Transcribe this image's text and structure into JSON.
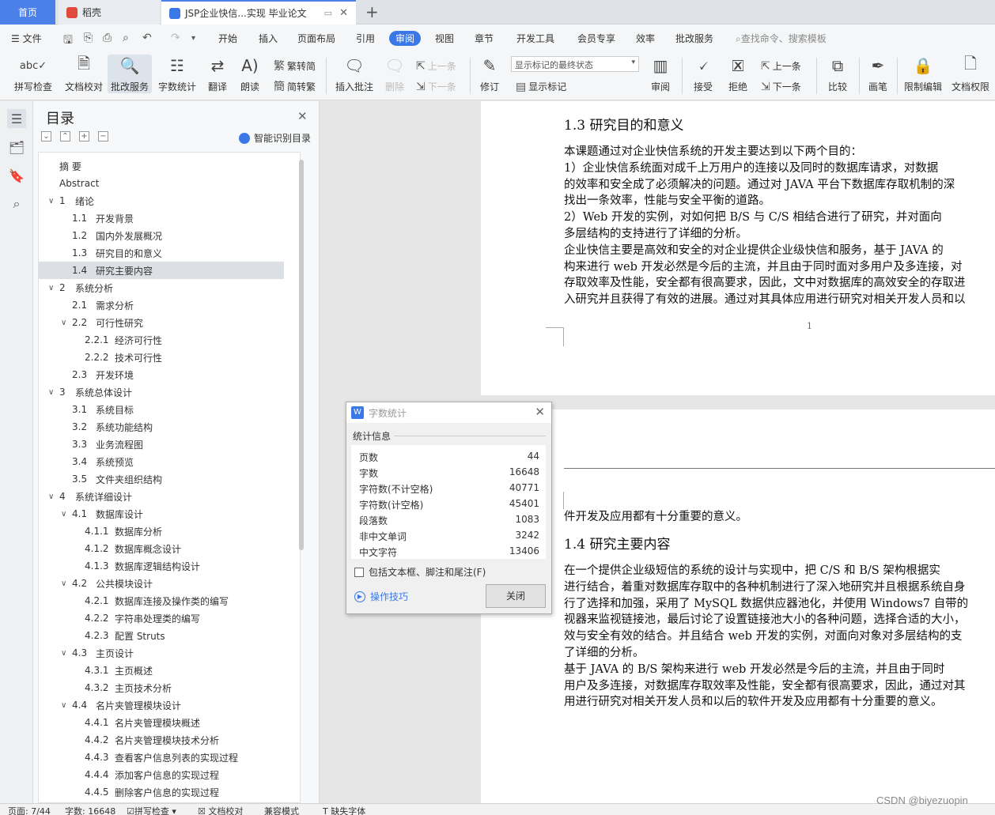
{
  "tabs": {
    "home": "首页",
    "daoke": "稻壳",
    "doc": "JSP企业快信...实现 毕业论文"
  },
  "menu": {
    "file": "文件",
    "items": [
      "开始",
      "插入",
      "页面布局",
      "引用",
      "审阅",
      "视图",
      "章节",
      "开发工具",
      "会员专享",
      "效率",
      "批改服务"
    ],
    "active": "审阅",
    "search": "查找命令、搜索模板"
  },
  "ribbon": {
    "spellcheck": "拼写检查",
    "doc_check": "文档校对",
    "revise_service": "批改服务",
    "word_count": "字数统计",
    "translate": "翻译",
    "read_aloud": "朗读",
    "trad_to_simp": "繁转简",
    "simp_to_trad": "简转繁",
    "insert_comment": "插入批注",
    "delete": "删除",
    "prev": "上一条",
    "next": "下一条",
    "track": "修订",
    "markup_select": "显示标记的最终状态",
    "show_markup": "显示标记",
    "review": "审阅",
    "accept": "接受",
    "reject": "拒绝",
    "prev2": "上一条",
    "next2": "下一条",
    "compare": "比较",
    "pen": "画笔",
    "restrict_edit": "限制编辑",
    "doc_rights": "文档权限"
  },
  "toc": {
    "title": "目录",
    "smart": "智能识别目录",
    "items": [
      {
        "num": "",
        "text": "摘  要",
        "level": 0
      },
      {
        "num": "",
        "text": "Abstract",
        "level": 0
      },
      {
        "num": "1",
        "text": "绪论",
        "level": 1,
        "expand": true
      },
      {
        "num": "1.1",
        "text": "开发背景",
        "level": 2
      },
      {
        "num": "1.2",
        "text": "国内外发展概况",
        "level": 2
      },
      {
        "num": "1.3",
        "text": "研究目的和意义",
        "level": 2
      },
      {
        "num": "1.4",
        "text": "研究主要内容",
        "level": 2,
        "selected": true
      },
      {
        "num": "2",
        "text": "系统分析",
        "level": 1,
        "expand": true
      },
      {
        "num": "2.1",
        "text": "需求分析",
        "level": 2
      },
      {
        "num": "2.2",
        "text": "可行性研究",
        "level": 2,
        "expand": true
      },
      {
        "num": "2.2.1",
        "text": "经济可行性",
        "level": 3
      },
      {
        "num": "2.2.2",
        "text": "技术可行性",
        "level": 3
      },
      {
        "num": "2.3",
        "text": "开发环境",
        "level": 2
      },
      {
        "num": "3",
        "text": "系统总体设计",
        "level": 1,
        "expand": true
      },
      {
        "num": "3.1",
        "text": "系统目标",
        "level": 2
      },
      {
        "num": "3.2",
        "text": "系统功能结构",
        "level": 2
      },
      {
        "num": "3.3",
        "text": "业务流程图",
        "level": 2
      },
      {
        "num": "3.4",
        "text": "系统预览",
        "level": 2
      },
      {
        "num": "3.5",
        "text": "文件夹组织结构",
        "level": 2
      },
      {
        "num": "4",
        "text": "系统详细设计",
        "level": 1,
        "expand": true
      },
      {
        "num": "4.1",
        "text": "数据库设计",
        "level": 2,
        "expand": true
      },
      {
        "num": "4.1.1",
        "text": "数据库分析",
        "level": 3
      },
      {
        "num": "4.1.2",
        "text": "数据库概念设计",
        "level": 3
      },
      {
        "num": "4.1.3",
        "text": "数据库逻辑结构设计",
        "level": 3
      },
      {
        "num": "4.2",
        "text": "公共模块设计",
        "level": 2,
        "expand": true
      },
      {
        "num": "4.2.1",
        "text": "数据库连接及操作类的编写",
        "level": 3
      },
      {
        "num": "4.2.2",
        "text": "字符串处理类的编写",
        "level": 3
      },
      {
        "num": "4.2.3",
        "text": "配置 Struts",
        "level": 3
      },
      {
        "num": "4.3",
        "text": "主页设计",
        "level": 2,
        "expand": true
      },
      {
        "num": "4.3.1",
        "text": "主页概述",
        "level": 3
      },
      {
        "num": "4.3.2",
        "text": "主页技术分析",
        "level": 3
      },
      {
        "num": "4.4",
        "text": "名片夹管理模块设计",
        "level": 2,
        "expand": true
      },
      {
        "num": "4.4.1",
        "text": "名片夹管理模块概述",
        "level": 3
      },
      {
        "num": "4.4.2",
        "text": "名片夹管理模块技术分析",
        "level": 3
      },
      {
        "num": "4.4.3",
        "text": "查看客户信息列表的实现过程",
        "level": 3
      },
      {
        "num": "4.4.4",
        "text": "添加客户信息的实现过程",
        "level": 3
      },
      {
        "num": "4.4.5",
        "text": "删除客户信息的实现过程",
        "level": 3
      }
    ]
  },
  "document": {
    "page1": {
      "heading": "1.3   研究目的和意义",
      "lines": [
        "      本课题通过对企业快信系统的开发主要达到以下两个目的：",
        "      1）企业快信系统面对成千上万用户的连接以及同时的数据库请求，对数据",
        "的效率和安全成了必须解决的问题。通过对 JAVA 平台下数据库存取机制的深",
        "找出一条效率，性能与安全平衡的道路。",
        "      2）Web 开发的实例，对如何把 B/S 与 C/S 相结合进行了研究，并对面向",
        "多层结构的支持进行了详细的分析。",
        "      企业快信主要是高效和安全的对企业提供企业级快信和服务，基于 JAVA 的",
        "构来进行 web 开发必然是今后的主流，并且由于同时面对多用户及多连接，对",
        "存取效率及性能，安全都有很高要求，因此，文中对数据库的高效安全的存取进",
        "入研究并且获得了有效的进展。通过对其具体应用进行研究对相关开发人员和以"
      ],
      "page_number": "1"
    },
    "page2": {
      "first_line": "件开发及应用都有十分重要的意义。",
      "heading": "1.4   研究主要内容",
      "lines": [
        "      在一个提供企业级短信的系统的设计与实现中，把 C/S 和 B/S 架构根据实",
        "进行结合，着重对数据库存取中的各种机制进行了深入地研究并且根据系统自身",
        "行了选择和加强，采用了 MySQL 数据供应器池化，并使用 Windows7 自带的",
        "视器来监视链接池，最后讨论了设置链接池大小的各种问题，选择合适的大小，",
        "效与安全有效的结合。并且结合 web 开发的实例，对面向对象对多层结构的支",
        "了详细的分析。",
        "      基于 JAVA 的 B/S 架构来进行 web 开发必然是今后的主流，并且由于同时",
        "用户及多连接，对数据库存取效率及性能，安全都有很高要求，因此，通过对其",
        "用进行研究对相关开发人员和以后的软件开发及应用都有十分重要的意义。"
      ]
    }
  },
  "dialog": {
    "title": "字数统计",
    "group": "统计信息",
    "stats": [
      {
        "k": "页数",
        "v": "44"
      },
      {
        "k": "字数",
        "v": "16648"
      },
      {
        "k": "字符数(不计空格)",
        "v": "40771"
      },
      {
        "k": "字符数(计空格)",
        "v": "45401"
      },
      {
        "k": "段落数",
        "v": "1083"
      },
      {
        "k": "非中文单词",
        "v": "3242"
      },
      {
        "k": "中文字符",
        "v": "13406"
      }
    ],
    "checkbox": "包括文本框、脚注和尾注(F)",
    "tips": "操作技巧",
    "close": "关闭"
  },
  "statusbar": {
    "page": "页面: 7/44",
    "words": "字数: 16648",
    "spell": "拼写检查",
    "doccheck": "文档校对",
    "compat": "兼容模式",
    "missing_font": "缺失字体"
  },
  "watermark": "CSDN @biyezuopin"
}
